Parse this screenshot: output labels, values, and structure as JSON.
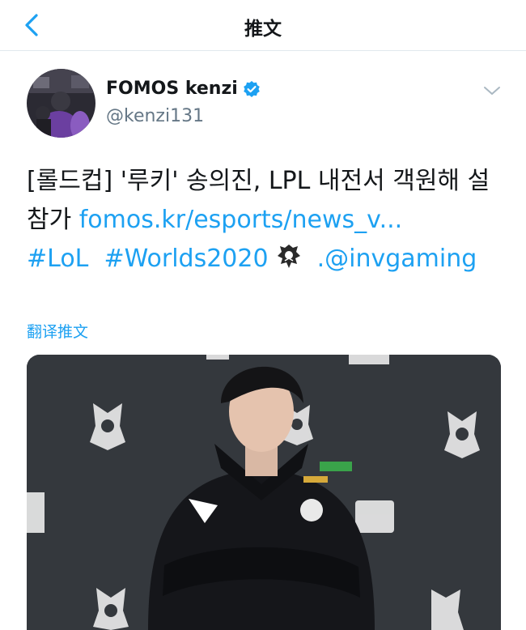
{
  "nav": {
    "title": "推文",
    "back_icon": "chevron-left-icon"
  },
  "author": {
    "display_name": "FOMOS kenzi",
    "handle": "@kenzi131",
    "verified": true
  },
  "tweet": {
    "text_plain": "[롤드컵] '루키' 송의진, LPL 내전서 객원해 설 참가 ",
    "link": "fomos.kr/esports/news_v...",
    "hashtag_1": "#LoL",
    "hashtag_2": "#Worlds2020",
    "emoji": "worlds-logo-emoji",
    "mention": ".@invgaming"
  },
  "translate_label": "翻译推文",
  "media": {
    "alt": "photo"
  },
  "colors": {
    "accent": "#1da1f2",
    "text": "#14171a",
    "muted": "#657786",
    "divider": "#e1e8ed"
  }
}
